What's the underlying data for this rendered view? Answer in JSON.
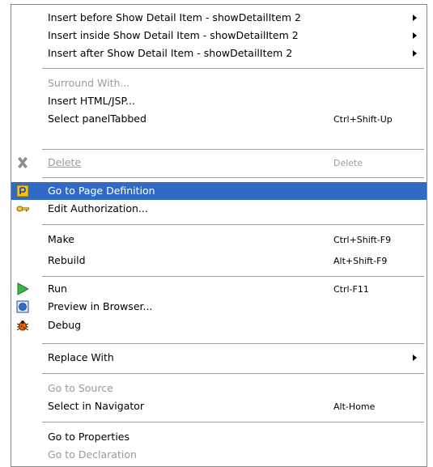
{
  "menu": {
    "items": [
      {
        "label": "Insert before Show Detail Item - showDetailItem 2",
        "shortcut": "",
        "submenu": true,
        "disabled": false,
        "icon": ""
      },
      {
        "label": "Insert inside Show Detail Item - showDetailItem 2",
        "shortcut": "",
        "submenu": true,
        "disabled": false,
        "icon": ""
      },
      {
        "label": "Insert after Show Detail Item - showDetailItem 2",
        "shortcut": "",
        "submenu": true,
        "disabled": false,
        "icon": ""
      },
      {
        "label": "Surround With...",
        "shortcut": "",
        "submenu": false,
        "disabled": true,
        "icon": ""
      },
      {
        "label": "Insert HTML/JSP...",
        "shortcut": "",
        "submenu": false,
        "disabled": false,
        "icon": ""
      },
      {
        "label": "Select panelTabbed",
        "shortcut": "Ctrl+Shift-Up",
        "submenu": false,
        "disabled": false,
        "icon": ""
      },
      {
        "label": "Delete",
        "shortcut": "Delete",
        "submenu": false,
        "disabled": true,
        "icon": "delete-x-icon"
      },
      {
        "label": "Go to Page Definition",
        "shortcut": "",
        "submenu": false,
        "disabled": false,
        "highlighted": true,
        "icon": "page-definition-icon"
      },
      {
        "label": "Edit Authorization...",
        "shortcut": "",
        "submenu": false,
        "disabled": false,
        "icon": "key-icon"
      },
      {
        "label": "Make",
        "shortcut": "Ctrl+Shift-F9",
        "submenu": false,
        "disabled": false,
        "icon": ""
      },
      {
        "label": "Rebuild",
        "shortcut": "Alt+Shift-F9",
        "submenu": false,
        "disabled": false,
        "icon": ""
      },
      {
        "label": "Run",
        "shortcut": "Ctrl-F11",
        "submenu": false,
        "disabled": false,
        "icon": "run-play-icon"
      },
      {
        "label": "Preview in Browser...",
        "shortcut": "",
        "submenu": false,
        "disabled": false,
        "icon": "browser-preview-icon"
      },
      {
        "label": "Debug",
        "shortcut": "",
        "submenu": false,
        "disabled": false,
        "icon": "debug-bug-icon"
      },
      {
        "label": "Replace With",
        "shortcut": "",
        "submenu": true,
        "disabled": false,
        "icon": ""
      },
      {
        "label": "Go to Source",
        "shortcut": "",
        "submenu": false,
        "disabled": true,
        "icon": ""
      },
      {
        "label": "Select in Navigator",
        "shortcut": "Alt-Home",
        "submenu": false,
        "disabled": false,
        "icon": ""
      },
      {
        "label": "Go to Properties",
        "shortcut": "",
        "submenu": false,
        "disabled": false,
        "icon": ""
      },
      {
        "label": "Go to Declaration",
        "shortcut": "",
        "submenu": false,
        "disabled": true,
        "icon": ""
      }
    ]
  },
  "colors": {
    "highlight": "#316ac5",
    "disabled_text": "#9b9b9b",
    "separator": "#a0a0a0"
  }
}
